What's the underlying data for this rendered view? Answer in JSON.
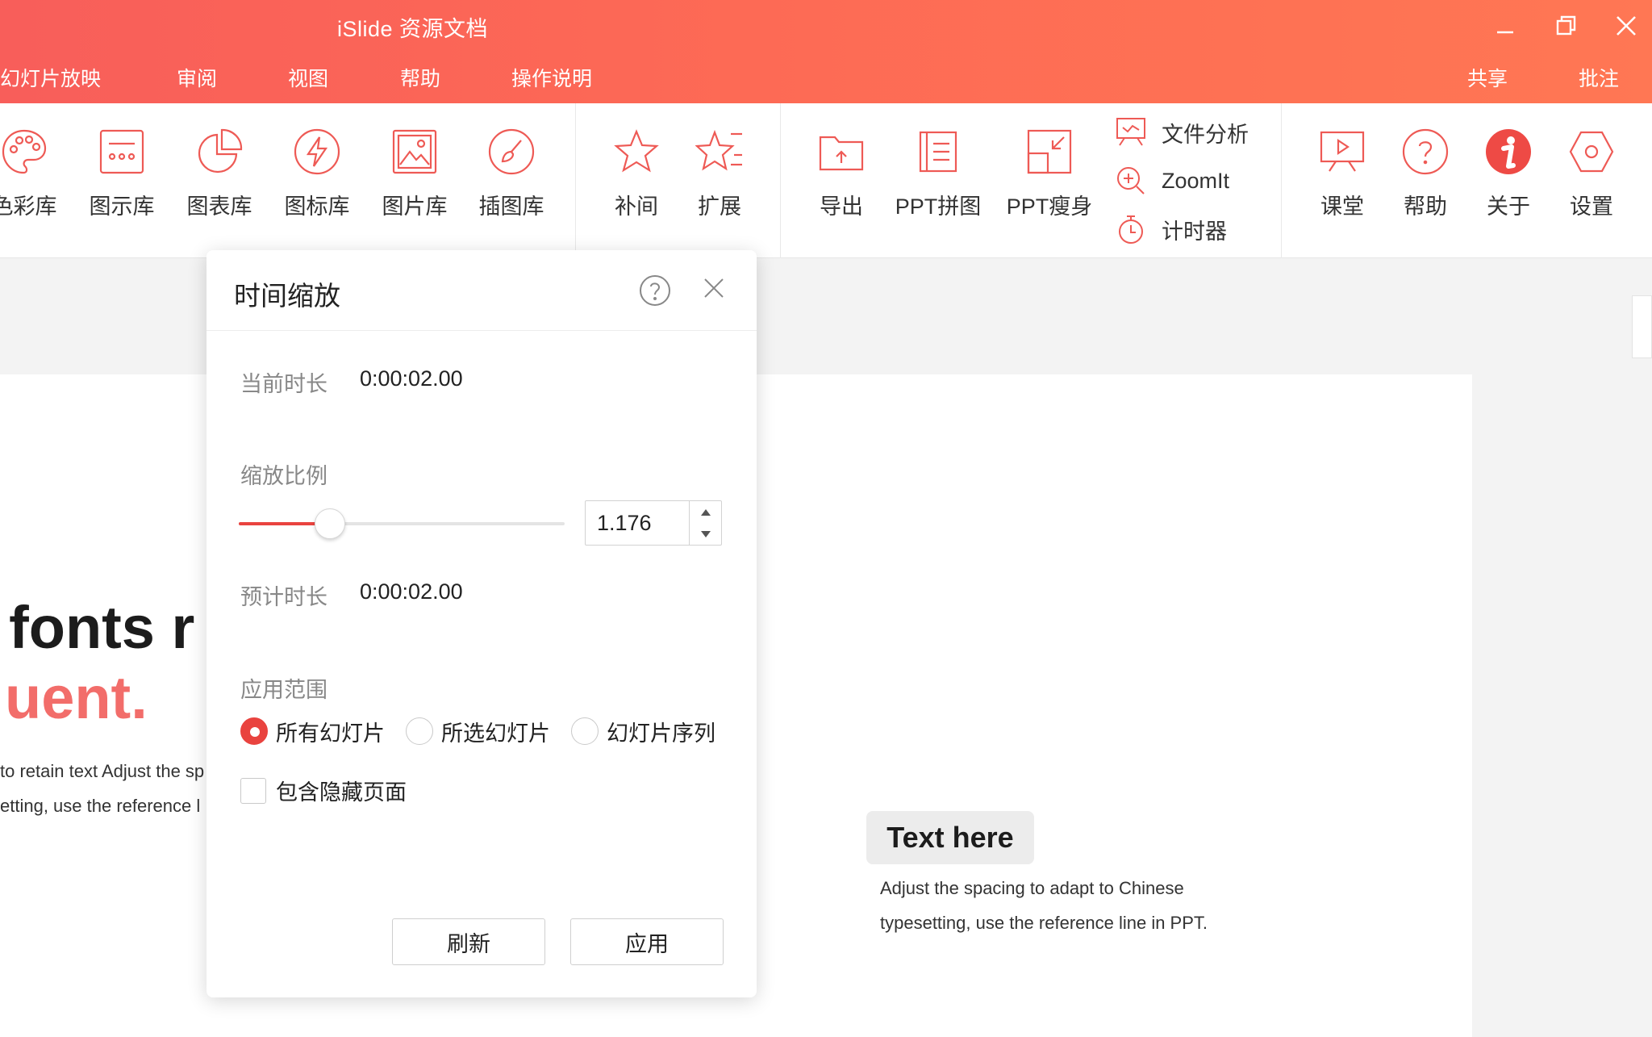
{
  "app": {
    "title": "iSlide 资源文档"
  },
  "menu": {
    "left": [
      "幻灯片放映",
      "审阅",
      "视图",
      "帮助",
      "操作说明"
    ],
    "right": [
      "共享",
      "批注"
    ]
  },
  "ribbon": {
    "resources": [
      {
        "label": "色彩库",
        "icon": "palette-icon"
      },
      {
        "label": "图示库",
        "icon": "diagram-icon"
      },
      {
        "label": "图表库",
        "icon": "pie-chart-icon"
      },
      {
        "label": "图标库",
        "icon": "lightning-icon"
      },
      {
        "label": "图片库",
        "icon": "image-icon"
      },
      {
        "label": "插图库",
        "icon": "brush-icon"
      }
    ],
    "animation": [
      {
        "label": "补间",
        "icon": "star-icon"
      },
      {
        "label": "扩展",
        "icon": "star-expand-icon"
      }
    ],
    "tools": [
      {
        "label": "导出",
        "icon": "export-folder-icon"
      },
      {
        "label": "PPT拼图",
        "icon": "ppt-collage-icon"
      },
      {
        "label": "PPT瘦身",
        "icon": "ppt-slim-icon"
      }
    ],
    "tools_small": [
      {
        "label": "文件分析",
        "icon": "file-analysis-icon"
      },
      {
        "label": "ZoomIt",
        "icon": "zoom-icon"
      },
      {
        "label": "计时器",
        "icon": "timer-icon"
      }
    ],
    "other": [
      {
        "label": "课堂",
        "icon": "classroom-icon"
      },
      {
        "label": "帮助",
        "icon": "help-icon"
      },
      {
        "label": "关于",
        "icon": "info-icon"
      },
      {
        "label": "设置",
        "icon": "settings-icon"
      }
    ]
  },
  "slide": {
    "headline_1": "l fonts r",
    "headline_2": "uent.",
    "body_1": "to retain text Adjust the sp",
    "body_2": "etting, use the reference l",
    "textbox_title": "Text here",
    "textbox_body_1": "Adjust the spacing to adapt to Chinese",
    "textbox_body_2": "typesetting, use the reference line in PPT."
  },
  "dialog": {
    "title": "时间缩放",
    "current_duration_label": "当前时长",
    "current_duration_value": "0:00:02.00",
    "scale_label": "缩放比例",
    "scale_value": "1.176",
    "scale_slider_fraction": 0.28,
    "estimated_duration_label": "预计时长",
    "estimated_duration_value": "0:00:02.00",
    "scope_label": "应用范围",
    "scope_options": [
      {
        "label": "所有幻灯片",
        "checked": true
      },
      {
        "label": "所选幻灯片",
        "checked": false
      },
      {
        "label": "幻灯片序列",
        "checked": false
      }
    ],
    "include_hidden_label": "包含隐藏页面",
    "include_hidden_checked": false,
    "refresh_label": "刷新",
    "apply_label": "应用"
  },
  "colors": {
    "accent": "#e9433f",
    "icon_stroke": "#ee5a55",
    "titlebar_start": "#f85e5a",
    "titlebar_end": "#ff7754"
  }
}
